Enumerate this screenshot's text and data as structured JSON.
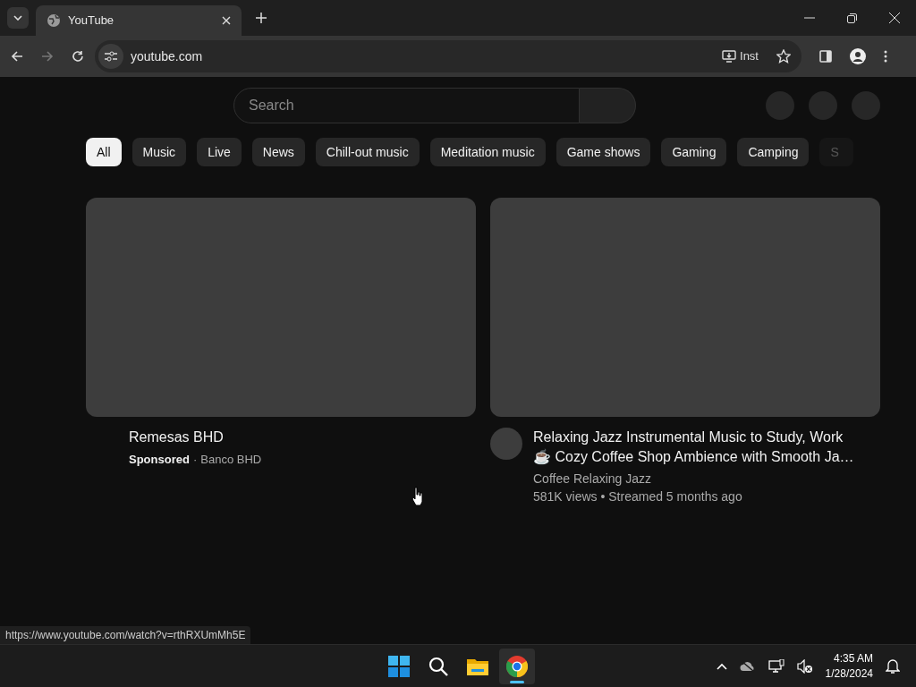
{
  "browser": {
    "tab_title": "YouTube",
    "address": "youtube.com",
    "install_label": "Inst",
    "status_url": "https://www.youtube.com/watch?v=rthRXUmMh5E"
  },
  "search": {
    "placeholder": "Search"
  },
  "chips": [
    {
      "label": "All",
      "selected": true
    },
    {
      "label": "Music",
      "selected": false
    },
    {
      "label": "Live",
      "selected": false
    },
    {
      "label": "News",
      "selected": false
    },
    {
      "label": "Chill-out music",
      "selected": false
    },
    {
      "label": "Meditation music",
      "selected": false
    },
    {
      "label": "Game shows",
      "selected": false
    },
    {
      "label": "Gaming",
      "selected": false
    },
    {
      "label": "Camping",
      "selected": false
    },
    {
      "label": "S",
      "selected": false
    }
  ],
  "videos": [
    {
      "kind": "ad",
      "title": "Remesas BHD",
      "badge": "Sponsored",
      "separator": "·",
      "channel": "Banco BHD"
    },
    {
      "kind": "video",
      "title_line_1": "Relaxing Jazz Instrumental Music to Study, Work",
      "title_line_2": "☕ Cozy Coffee Shop Ambience with Smooth Ja…",
      "channel": "Coffee Relaxing Jazz",
      "meta": "581K views • Streamed 5 months ago"
    }
  ],
  "taskbar": {
    "time": "4:35 AM",
    "date": "1/28/2024"
  }
}
